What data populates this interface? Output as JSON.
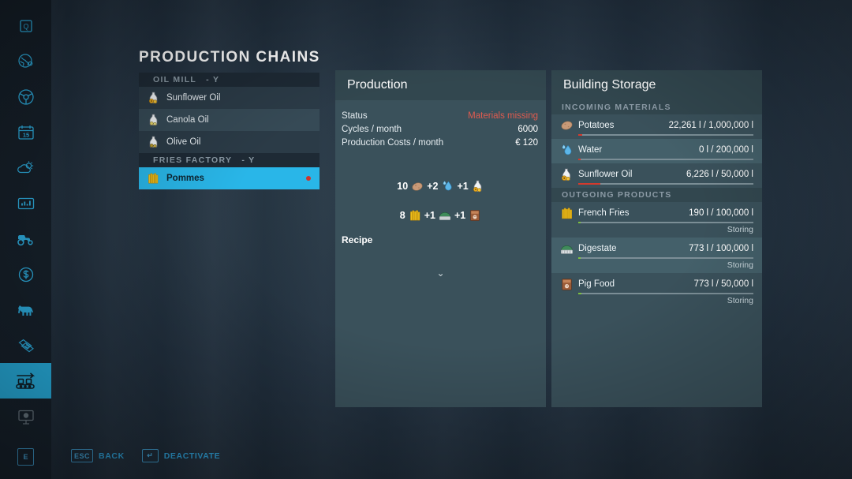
{
  "rail": {
    "items": [
      {
        "name": "quests-icon",
        "label": "Q"
      },
      {
        "name": "map-globe-icon",
        "label": "Globe"
      },
      {
        "name": "vehicle-steering-icon",
        "label": "Steering Wheel"
      },
      {
        "name": "calendar-icon",
        "label": "15"
      },
      {
        "name": "weather-icon",
        "label": "Weather"
      },
      {
        "name": "statistics-icon",
        "label": "Statistics"
      },
      {
        "name": "vehicles-icon",
        "label": "Tractor"
      },
      {
        "name": "finances-icon",
        "label": "Finances"
      },
      {
        "name": "animals-icon",
        "label": "Animals"
      },
      {
        "name": "contracts-icon",
        "label": "Contracts"
      },
      {
        "name": "production-icon",
        "label": "Production"
      },
      {
        "name": "gallery-icon",
        "label": "Gallery"
      }
    ],
    "active_index": 10
  },
  "chains": {
    "title": "PRODUCTION CHAINS",
    "groups": [
      {
        "name": "OIL MILL",
        "key": "-  Y",
        "items": [
          {
            "label": "Sunflower Oil",
            "icon": "oil-bottle-icon",
            "selected": false,
            "alert": false
          },
          {
            "label": "Canola Oil",
            "icon": "oil-bottle-icon",
            "selected": false,
            "alert": false
          },
          {
            "label": "Olive Oil",
            "icon": "oil-bottle-icon",
            "selected": false,
            "alert": false
          }
        ]
      },
      {
        "name": "FRIES FACTORY",
        "key": "-  Y",
        "items": [
          {
            "label": "Pommes",
            "icon": "french-fries-icon",
            "selected": true,
            "alert": true
          }
        ]
      }
    ]
  },
  "production": {
    "title": "Production",
    "rows": [
      {
        "label": "Status",
        "value": "Materials missing",
        "alert": true
      },
      {
        "label": "Cycles / month",
        "value": "6000",
        "alert": false
      },
      {
        "label": "Production Costs / month",
        "value": "€ 120",
        "alert": false
      }
    ],
    "recipe_label": "Recipe",
    "arrow": "⌄",
    "inputs": [
      {
        "amount": "10",
        "icon": "potato-icon"
      },
      {
        "amount": "+2",
        "icon": "water-drop-icon"
      },
      {
        "amount": "+1",
        "icon": "oil-bottle-icon"
      }
    ],
    "outputs": [
      {
        "amount": "8",
        "icon": "french-fries-icon"
      },
      {
        "amount": "+1",
        "icon": "digestate-icon"
      },
      {
        "amount": "+1",
        "icon": "pig-food-icon"
      }
    ]
  },
  "storage": {
    "title": "Building Storage",
    "sections": [
      {
        "heading": "INCOMING MATERIALS",
        "items": [
          {
            "name": "Potatoes",
            "icon": "potato-icon",
            "amount": "22,261 l / 1,000,000 l",
            "fill_pct": 2.2,
            "bar_color": "red",
            "status": ""
          },
          {
            "name": "Water",
            "icon": "water-drop-icon",
            "amount": "0 l / 200,000 l",
            "fill_pct": 1.5,
            "bar_color": "red",
            "status": ""
          },
          {
            "name": "Sunflower Oil",
            "icon": "oil-bottle-icon",
            "amount": "6,226 l / 50,000 l",
            "fill_pct": 12.5,
            "bar_color": "red",
            "status": ""
          }
        ]
      },
      {
        "heading": "OUTGOING PRODUCTS",
        "items": [
          {
            "name": "French Fries",
            "icon": "french-fries-icon",
            "amount": "190 l / 100,000 l",
            "fill_pct": 1.4,
            "bar_color": "green",
            "status": "Storing"
          },
          {
            "name": "Digestate",
            "icon": "digestate-icon",
            "amount": "773 l / 100,000 l",
            "fill_pct": 1.4,
            "bar_color": "green",
            "status": "Storing"
          },
          {
            "name": "Pig Food",
            "icon": "pig-food-icon",
            "amount": "773 l / 50,000 l",
            "fill_pct": 1.6,
            "bar_color": "green",
            "status": "Storing"
          }
        ]
      }
    ]
  },
  "footer": {
    "e_key": "E",
    "actions": [
      {
        "key": "ESC",
        "label": "BACK"
      },
      {
        "key": "↵",
        "label": "DEACTIVATE"
      }
    ]
  },
  "colors": {
    "accent": "#29b6e8",
    "panel": "#3a515b",
    "panel_head": "#32474f",
    "alert": "#e05b4f",
    "bar_red": "#d53a2d",
    "bar_green": "#7ec13f",
    "key_blue": "#3e97c7"
  }
}
